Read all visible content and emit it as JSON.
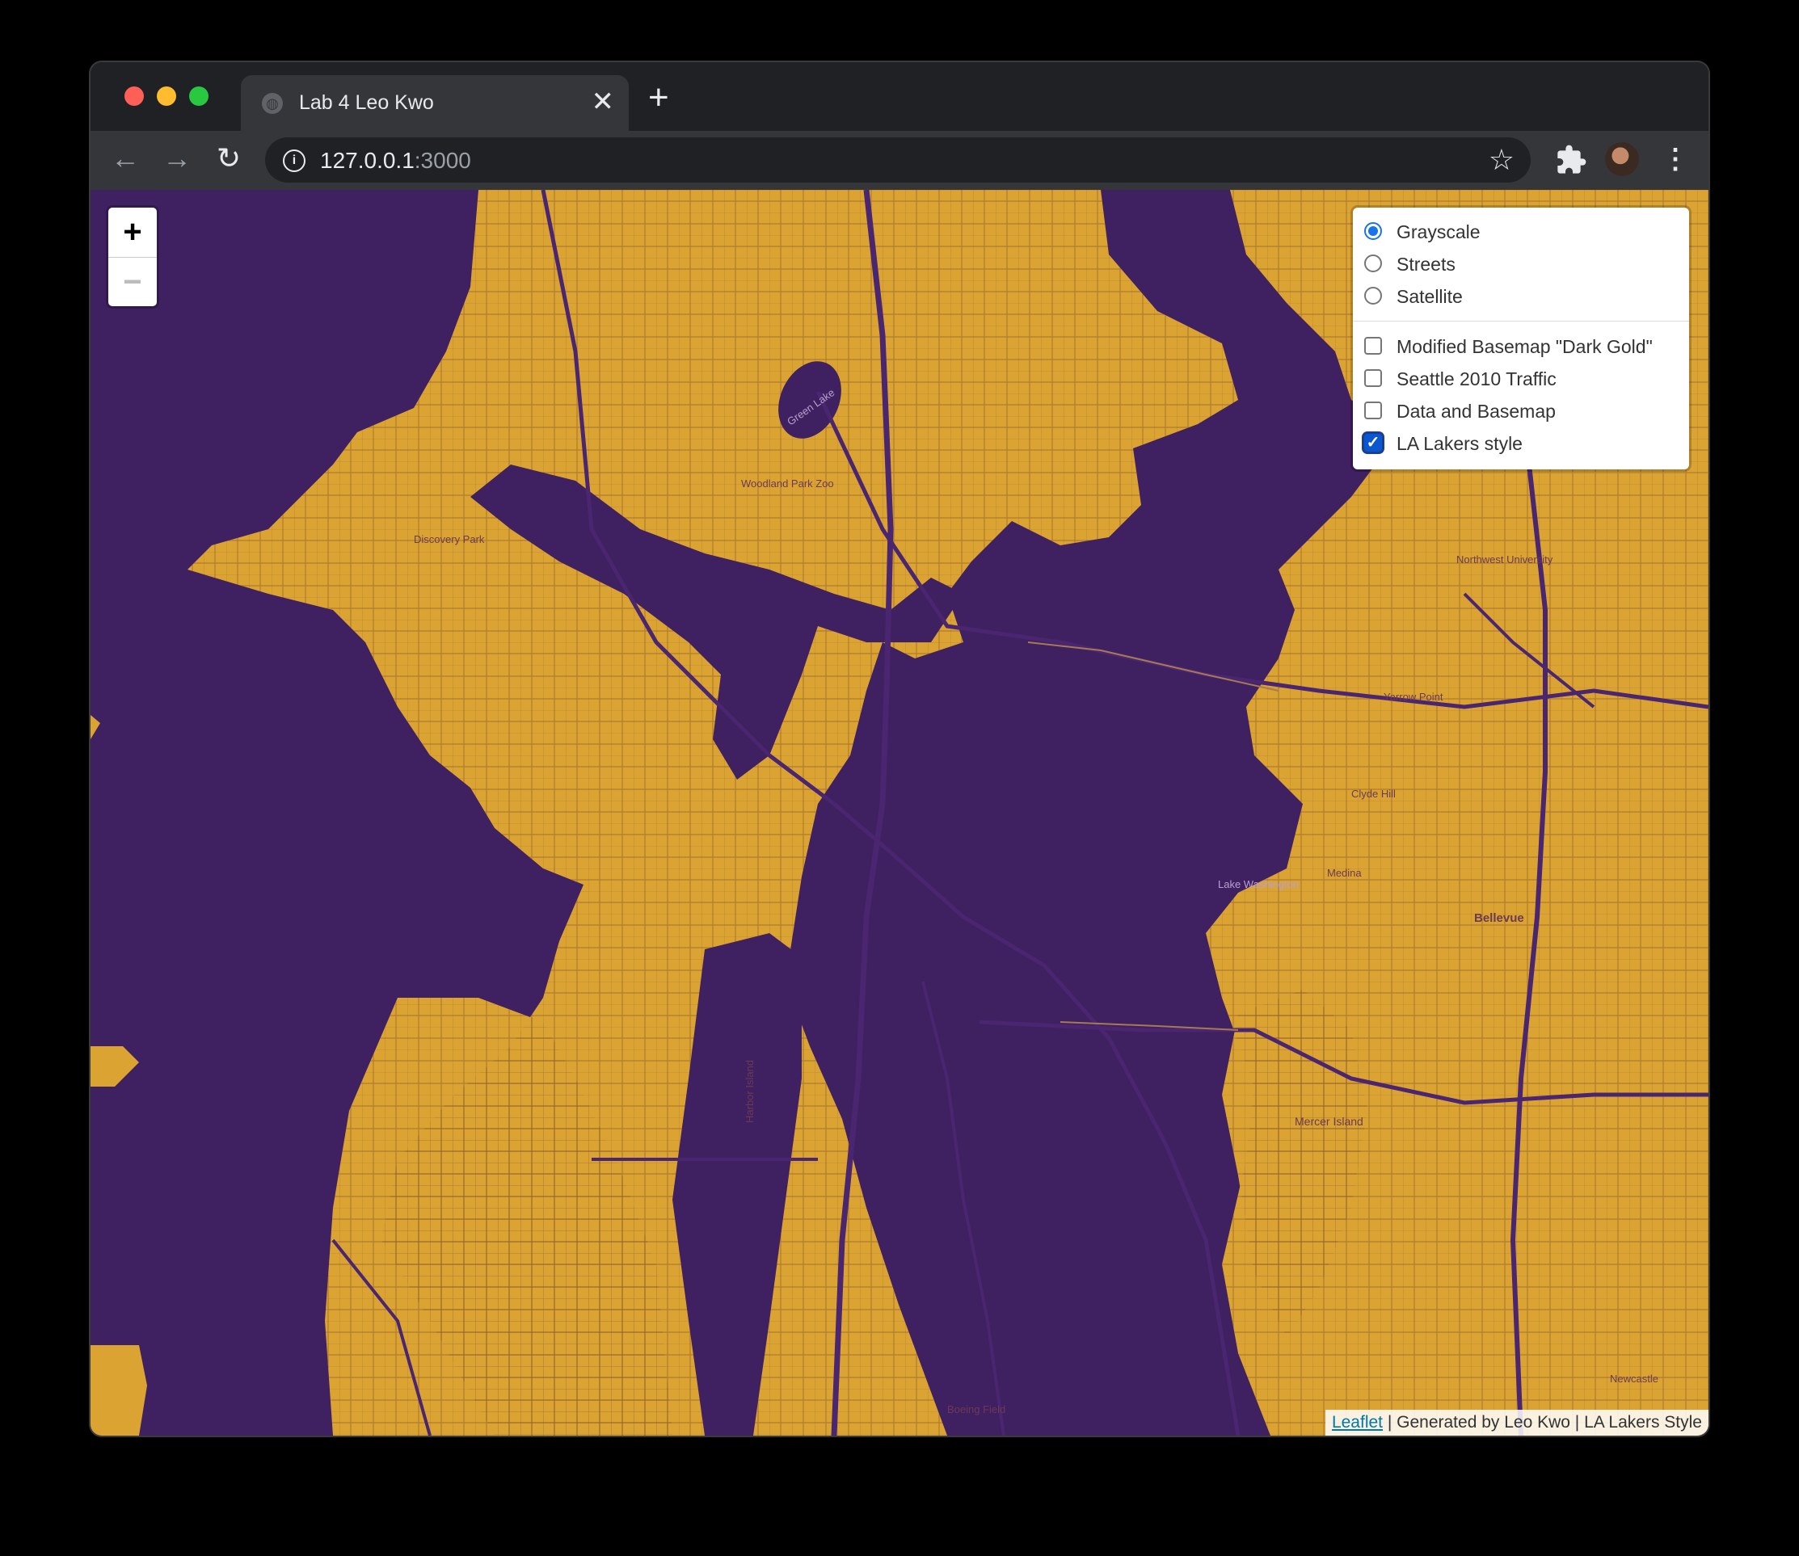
{
  "browser": {
    "tab_title": "Lab 4 Leo Kwo",
    "tab_close": "✕",
    "new_tab": "+",
    "back": "←",
    "forward": "→",
    "reload": "↻",
    "url_host": "127.0.0.1",
    "url_port": ":3000",
    "bookmark_star": "☆",
    "menu": "⋮"
  },
  "map": {
    "colors": {
      "water": "#3f2060",
      "land": "#dba332",
      "roads": "#4a2570"
    },
    "zoom": {
      "in_label": "+",
      "out_label": "−"
    },
    "base_layers": [
      {
        "label": "Grayscale",
        "selected": true
      },
      {
        "label": "Streets",
        "selected": false
      },
      {
        "label": "Satellite",
        "selected": false
      }
    ],
    "overlays": [
      {
        "label": "Modified Basemap \"Dark Gold\"",
        "checked": false
      },
      {
        "label": "Seattle 2010 Traffic",
        "checked": false
      },
      {
        "label": "Data and Basemap",
        "checked": false
      },
      {
        "label": "LA Lakers style",
        "checked": true
      }
    ],
    "attribution": {
      "link": "Leaflet",
      "text": " | Generated by Leo Kwo | LA Lakers Style"
    },
    "place_labels": [
      "Green Lake",
      "Discovery Park",
      "Woodland Park Zoo",
      "Lake Washington",
      "Bellevue",
      "Mercer Island",
      "Harbor Island",
      "Boeing Field",
      "Yarrow Point",
      "Clyde Hill",
      "Medina",
      "Newcastle",
      "Northwest University"
    ]
  }
}
